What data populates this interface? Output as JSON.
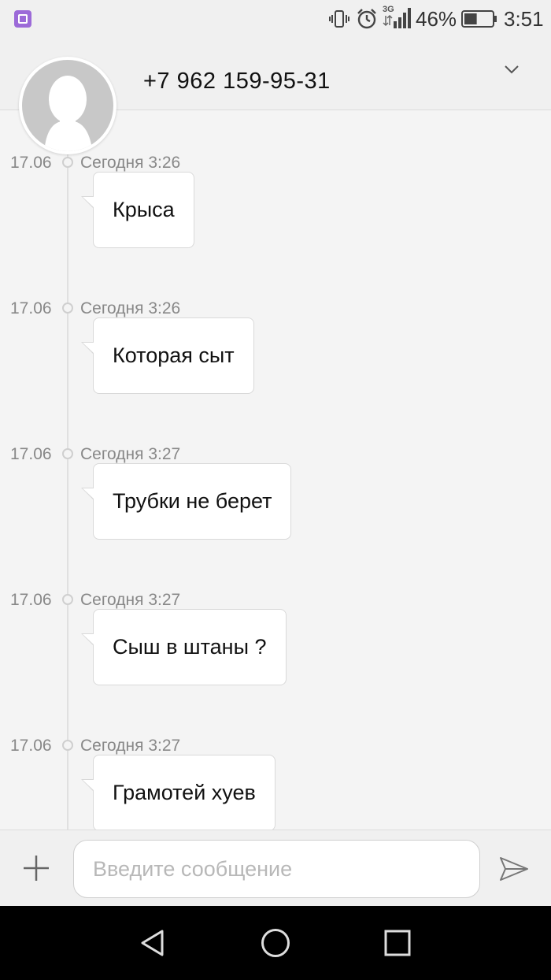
{
  "status_bar": {
    "network_label": "3G",
    "battery_percent": "46%",
    "battery_level": 0.46,
    "time": "3:51",
    "icons": [
      "app-notification-icon",
      "vibrate-icon",
      "alarm-icon",
      "signal-icon",
      "battery-icon"
    ]
  },
  "header": {
    "contact": "+7 962 159-95-31",
    "icons": [
      "avatar",
      "chevron-down-icon"
    ]
  },
  "messages": [
    {
      "date": "17.06",
      "time": "Сегодня 3:26",
      "text": "Крыса"
    },
    {
      "date": "17.06",
      "time": "Сегодня 3:26",
      "text": "Которая сыт"
    },
    {
      "date": "17.06",
      "time": "Сегодня 3:27",
      "text": "Трубки не берет"
    },
    {
      "date": "17.06",
      "time": "Сегодня 3:27",
      "text": "Сыш в штаны ?"
    },
    {
      "date": "17.06",
      "time": "Сегодня 3:27",
      "text": "Грамотей хуев"
    }
  ],
  "composer": {
    "placeholder": "Введите сообщение",
    "value": "",
    "icons": [
      "add-icon",
      "send-icon"
    ]
  },
  "nav_bar": {
    "icons": [
      "back-icon",
      "home-icon",
      "recents-icon"
    ]
  },
  "colors": {
    "background": "#f4f4f4",
    "bars": "#f0f0f0",
    "bubble": "#ffffff",
    "muted_text": "#888888",
    "app_icon": "#9c6ad8"
  }
}
